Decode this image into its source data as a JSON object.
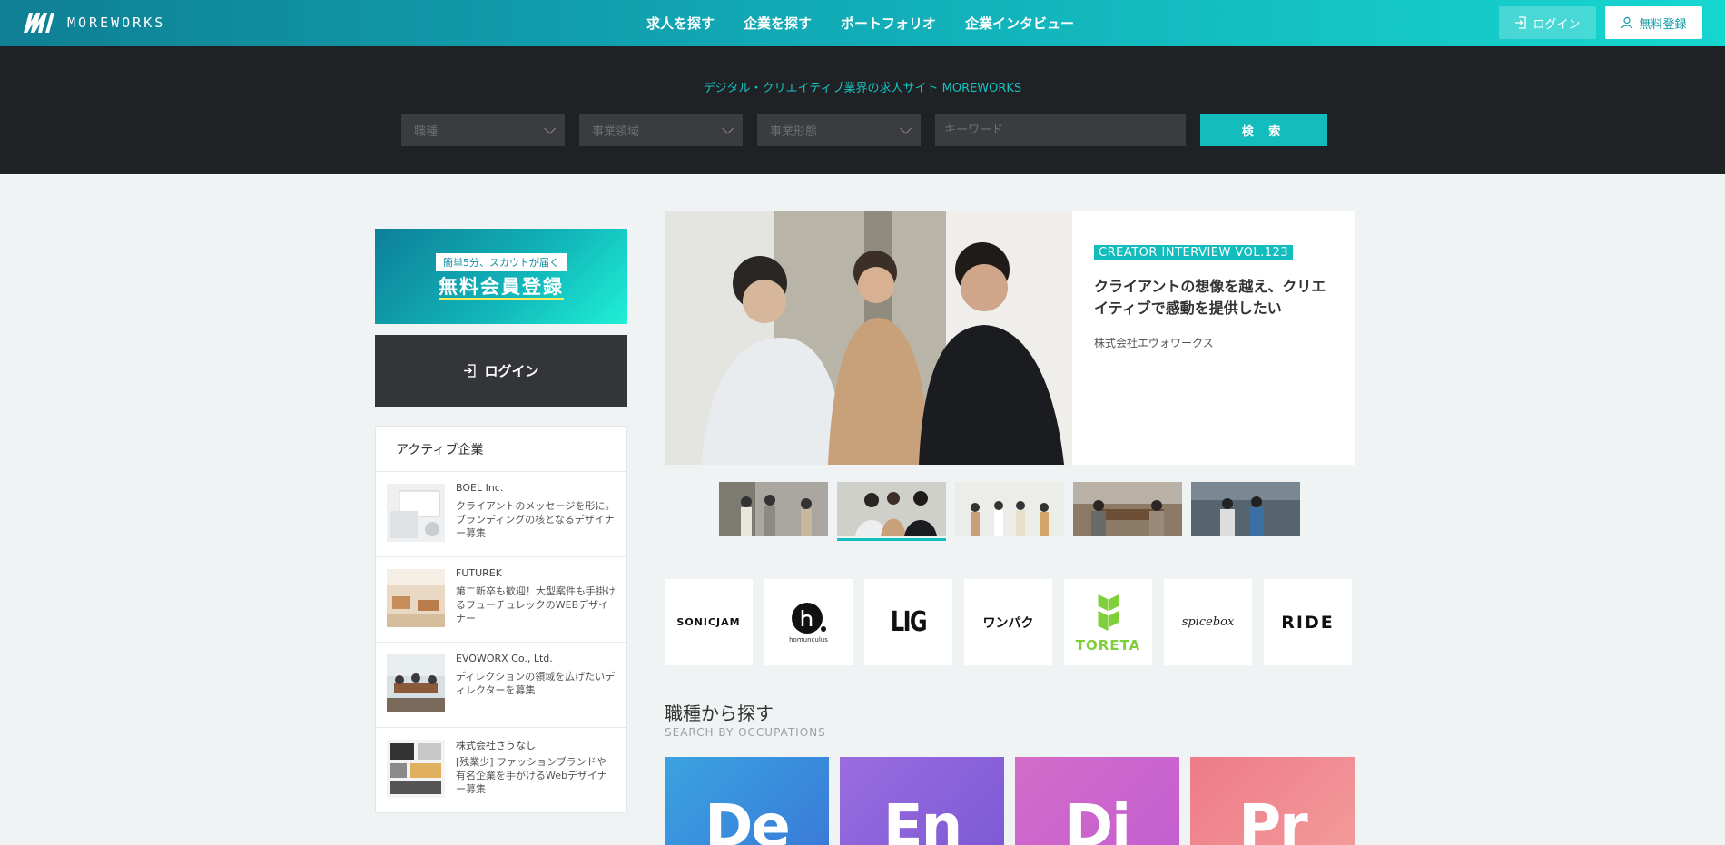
{
  "header": {
    "logo_text": "MOREWORKS",
    "nav": [
      "求人を探す",
      "企業を探す",
      "ポートフォリオ",
      "企業インタビュー"
    ],
    "login_label": "ログイン",
    "register_label": "無料登録"
  },
  "search": {
    "tagline": "デジタル・クリエイティブ業界の求人サイト MOREWORKS",
    "occupation": "職種",
    "domain": "事業領域",
    "form": "事業形態",
    "keyword_placeholder": "キーワード",
    "button": "検 索"
  },
  "sidebar": {
    "register_pill": "簡単5分、スカウトが届く",
    "register_big": "無料会員登録",
    "login_label": "ログイン",
    "active_title": "アクティブ企業",
    "companies": [
      {
        "name": "BOEL Inc.",
        "desc": "クライアントのメッセージを形に。ブランディングの核となるデザイナー募集"
      },
      {
        "name": "FUTUREK",
        "desc": "第二新卒も歓迎！大型案件も手掛けるフューチュレックのWEBデザイナー"
      },
      {
        "name": "EVOWORX Co., Ltd.",
        "desc": "ディレクションの領域を広げたいディレクターを募集"
      },
      {
        "name": "株式会社さうなし",
        "desc": "[残業少] ファッションブランドや有名企業を手がけるWebデザイナー募集"
      }
    ]
  },
  "feature": {
    "vol": "CREATOR INTERVIEW VOL.123",
    "title": "クライアントの想像を越え、クリエイティブで感動を提供したい",
    "company": "株式会社エヴォワークス"
  },
  "logos": [
    "SONICJAM",
    "homunculus",
    "LIG",
    "ワンパク",
    "TORETA",
    "spicebox",
    "RIDE"
  ],
  "occupations": {
    "title": "職種から探す",
    "subtitle": "SEARCH BY OCCUPATIONS",
    "tiles": [
      {
        "letters": "De",
        "color_from": "#3aa3e0",
        "color_to": "#3a7bd8"
      },
      {
        "letters": "En",
        "color_from": "#9b6cdf",
        "color_to": "#7d5ad6"
      },
      {
        "letters": "Di",
        "color_from": "#d46cc9",
        "color_to": "#c45fd0"
      },
      {
        "letters": "Pr",
        "color_from": "#ee7a88",
        "color_to": "#f29a9a"
      }
    ]
  },
  "colors": {
    "accent": "#14bdbd",
    "dark": "#202124"
  }
}
